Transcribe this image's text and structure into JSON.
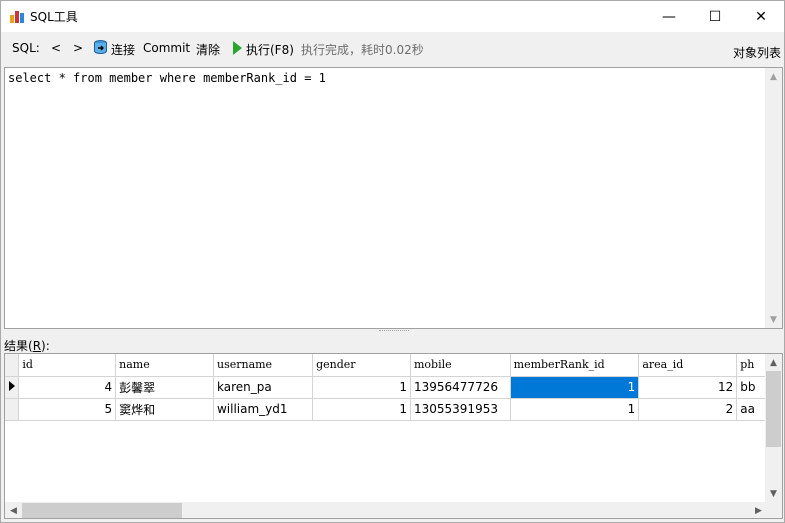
{
  "window": {
    "title": "SQL工具",
    "controls": {
      "minimize": "—",
      "maximize": "☐",
      "close": "✕"
    }
  },
  "toolbar": {
    "sql_label": "SQL:",
    "prev": "<",
    "next": ">",
    "connect": "连接",
    "commit": "Commit",
    "clear": "清除",
    "run": "执行(F8)",
    "status": "执行完成，耗时0.02秒",
    "objects": "对象列表"
  },
  "editor": {
    "sql": "select * from member where memberRank_id = 1"
  },
  "results": {
    "label": "结果(",
    "label_key": "R",
    "label_end": "):",
    "columns": [
      "id",
      "name",
      "username",
      "gender",
      "mobile",
      "memberRank_id",
      "area_id",
      "ph"
    ],
    "rows": [
      [
        "4",
        "彭馨翠",
        "karen_pa",
        "1",
        "13956477726",
        "1",
        "12",
        "bb"
      ],
      [
        "5",
        "窦烨和",
        "william_yd1",
        "1",
        "13055391953",
        "1",
        "2",
        "aa"
      ]
    ],
    "selected": {
      "row": 0,
      "column": "memberRank_id"
    }
  },
  "colors": {
    "selection": "#0078d7",
    "run_icon": "#2aa52a",
    "status_text": "#6d6d6d"
  },
  "icons": [
    "app-icon",
    "connect-icon",
    "run-icon",
    "row-indicator-icon"
  ]
}
